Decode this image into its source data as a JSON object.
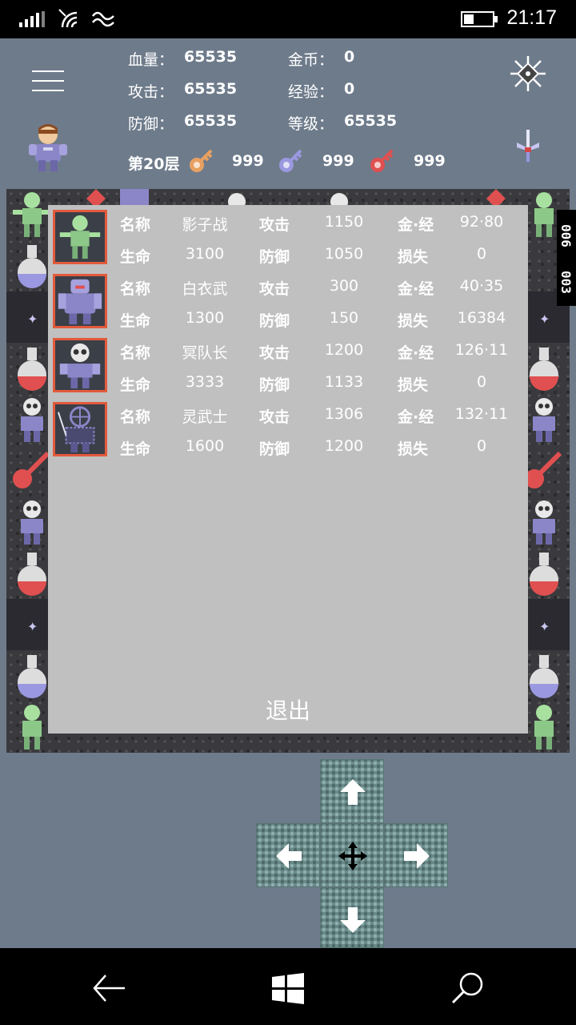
{
  "status_bar": {
    "time": "21:17"
  },
  "header": {
    "stats": [
      {
        "label": "血量：",
        "value": "65535"
      },
      {
        "label": "攻击：",
        "value": "65535"
      },
      {
        "label": "防御：",
        "value": "65535"
      },
      {
        "label": "金币：",
        "value": "0"
      },
      {
        "label": "经验：",
        "value": "0"
      },
      {
        "label": "等级：",
        "value": "65535"
      }
    ],
    "floor": "第20层",
    "keys": [
      {
        "color": "#e8a060",
        "count": "999"
      },
      {
        "color": "#9a98e0",
        "count": "999"
      },
      {
        "color": "#e05050",
        "count": "999"
      }
    ]
  },
  "side_badge": [
    "006",
    "003"
  ],
  "monster_panel": {
    "col_labels": {
      "name": "名称",
      "hp": "生命",
      "atk": "攻击",
      "def": "防御",
      "gold_exp": "金·经",
      "loss": "损失"
    },
    "monsters": [
      {
        "name": "影子战",
        "hp": "3100",
        "atk": "1150",
        "def": "1050",
        "gold_exp": "92·80",
        "loss": "0",
        "sprite": "zombie"
      },
      {
        "name": "白衣武",
        "hp": "1300",
        "atk": "300",
        "def": "150",
        "gold_exp": "40·35",
        "loss": "16384",
        "sprite": "knight"
      },
      {
        "name": "冥队长",
        "hp": "3333",
        "atk": "1200",
        "def": "1133",
        "gold_exp": "126·11",
        "loss": "0",
        "sprite": "skeleton"
      },
      {
        "name": "灵武士",
        "hp": "1600",
        "atk": "1306",
        "def": "1200",
        "gold_exp": "132·11",
        "loss": "0",
        "sprite": "ghost-warrior"
      }
    ],
    "exit_label": "退出"
  },
  "colors": {
    "background": "#6e7b8b",
    "panel": "#c0c0c0",
    "portrait_border": "#e25a3c"
  }
}
